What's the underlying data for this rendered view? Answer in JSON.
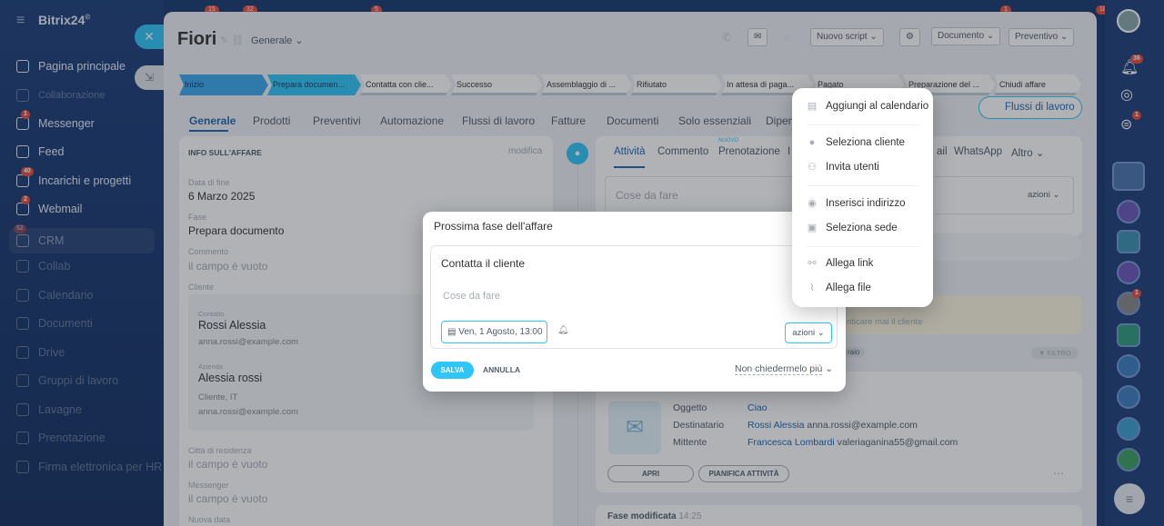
{
  "app": {
    "name": "Bitrix24",
    "suffix": "©"
  },
  "top_badges": [
    "15",
    "32",
    "5",
    "1",
    "18"
  ],
  "sidebar": {
    "items": [
      {
        "label": "Pagina principale",
        "icon": "home-icon",
        "badge": ""
      },
      {
        "label": "Collaborazione",
        "icon": "collab-icon",
        "badge": ""
      },
      {
        "label": "Messenger",
        "icon": "chat-icon",
        "badge": "1"
      },
      {
        "label": "Feed",
        "icon": "feed-icon",
        "badge": ""
      },
      {
        "label": "Incarichi e progetti",
        "icon": "tasks-icon",
        "badge": "40"
      },
      {
        "label": "Webmail",
        "icon": "mail-icon",
        "badge": "2"
      },
      {
        "label": "CRM",
        "icon": "crm-icon",
        "badge": "52"
      },
      {
        "label": "Collab",
        "icon": "collab2-icon",
        "badge": ""
      },
      {
        "label": "Calendario",
        "icon": "calendar-icon",
        "badge": ""
      },
      {
        "label": "Documenti",
        "icon": "docs-icon",
        "badge": ""
      },
      {
        "label": "Drive",
        "icon": "drive-icon",
        "badge": ""
      },
      {
        "label": "Gruppi di lavoro",
        "icon": "groups-icon",
        "badge": ""
      },
      {
        "label": "Lavagne",
        "icon": "boards-icon",
        "badge": ""
      },
      {
        "label": "Prenotazione",
        "icon": "booking-icon",
        "badge": ""
      },
      {
        "label": "Firma elettronica per HR",
        "icon": "sign-icon",
        "badge": ""
      }
    ]
  },
  "deal": {
    "title": "Fiori",
    "category": "Generale"
  },
  "header_buttons": {
    "script": "Nuovo script",
    "document": "Documento",
    "quote": "Preventivo"
  },
  "stages": [
    {
      "label": "Inizio",
      "color": "#39a8ef"
    },
    {
      "label": "Prepara documen...",
      "color": "#2fc6f6"
    },
    {
      "label": "Contatta con clie...",
      "color": "#c6cdd3"
    },
    {
      "label": "Successo",
      "color": "#c6cdd3"
    },
    {
      "label": "Assemblaggio di ...",
      "color": "#c6cdd3"
    },
    {
      "label": "Rifiutato",
      "color": "#c6cdd3"
    },
    {
      "label": "In attesa di paga...",
      "color": "#c6cdd3"
    },
    {
      "label": "Pagato",
      "color": "#c6cdd3"
    },
    {
      "label": "Preparazione del ...",
      "color": "#c6cdd3"
    },
    {
      "label": "Chiudi affare",
      "color": "#c6cdd3"
    }
  ],
  "tabs": [
    "Generale",
    "Prodotti",
    "Preventivi",
    "Automazione",
    "Flussi di lavoro",
    "Fatture",
    "Documenti",
    "Solo essenziali",
    "Dipen"
  ],
  "workflow_button": "Flussi di lavoro",
  "info": {
    "section_title": "INFO SULL'AFFARE",
    "edit_link": "modifica",
    "end_date_label": "Data di fine",
    "end_date": "6 Marzo 2025",
    "stage_label": "Fase",
    "stage": "Prepara documento",
    "comment_label": "Commento",
    "comment": "il campo è vuoto",
    "client_label": "Cliente",
    "contact_label": "Contatto",
    "contact_name": "Rossi Alessia",
    "contact_email": "anna.rossi@example.com",
    "company_label": "Azienda",
    "company_name": "Alessia rossi",
    "company_type": "Cliente, IT",
    "company_email": "anna.rossi@example.com",
    "city_label": "Città di residenza",
    "city": "il campo è vuoto",
    "messenger_label": "Messenger",
    "messenger": "il campo è vuoto",
    "new_date_label": "Nuova data"
  },
  "timeline": {
    "tabs": [
      "Attività",
      "Commento",
      "Prenotazione",
      "I",
      "ail",
      "WhatsApp",
      "Altro"
    ],
    "new_badge": "NUOVO",
    "todo_placeholder": "Cose da fare",
    "actions_label": "azioni",
    "notice": "nticare mai il cliente",
    "section_tag": "raio",
    "filter": "FILTRO",
    "email": {
      "subject_label": "Oggetto",
      "subject": "Ciao",
      "recipient_label": "Destinatario",
      "recipient_name": "Rossi Alessia",
      "recipient_email": "anna.rossi@example.com",
      "sender_label": "Mittente",
      "sender_name": "Francesca Lombardi",
      "sender_email": "valeriaganina55@gmail.com",
      "open_btn": "APRI",
      "plan_btn": "PIANIFICA ATTIVITÀ"
    },
    "stage_changed": "Fase modificata",
    "stage_changed_time": "14:25"
  },
  "modal": {
    "title": "Prossima fase dell'affare",
    "task_value": "Contatta il cliente",
    "todo_placeholder": "Cose da fare",
    "date": "Ven, 1 Agosto, 13:00",
    "actions": "azioni",
    "save": "SALVA",
    "cancel": "ANNULLA",
    "dont_ask": "Non chiedermelo più"
  },
  "popup": {
    "items": [
      "Aggiungi al calendario",
      "Seleziona cliente",
      "Invita utenti",
      "Inserisci indirizzo",
      "Seleziona sede",
      "Allega link",
      "Allega file"
    ]
  },
  "right_badges": {
    "notifications": "36",
    "chat": "1",
    "avatar": "1"
  }
}
